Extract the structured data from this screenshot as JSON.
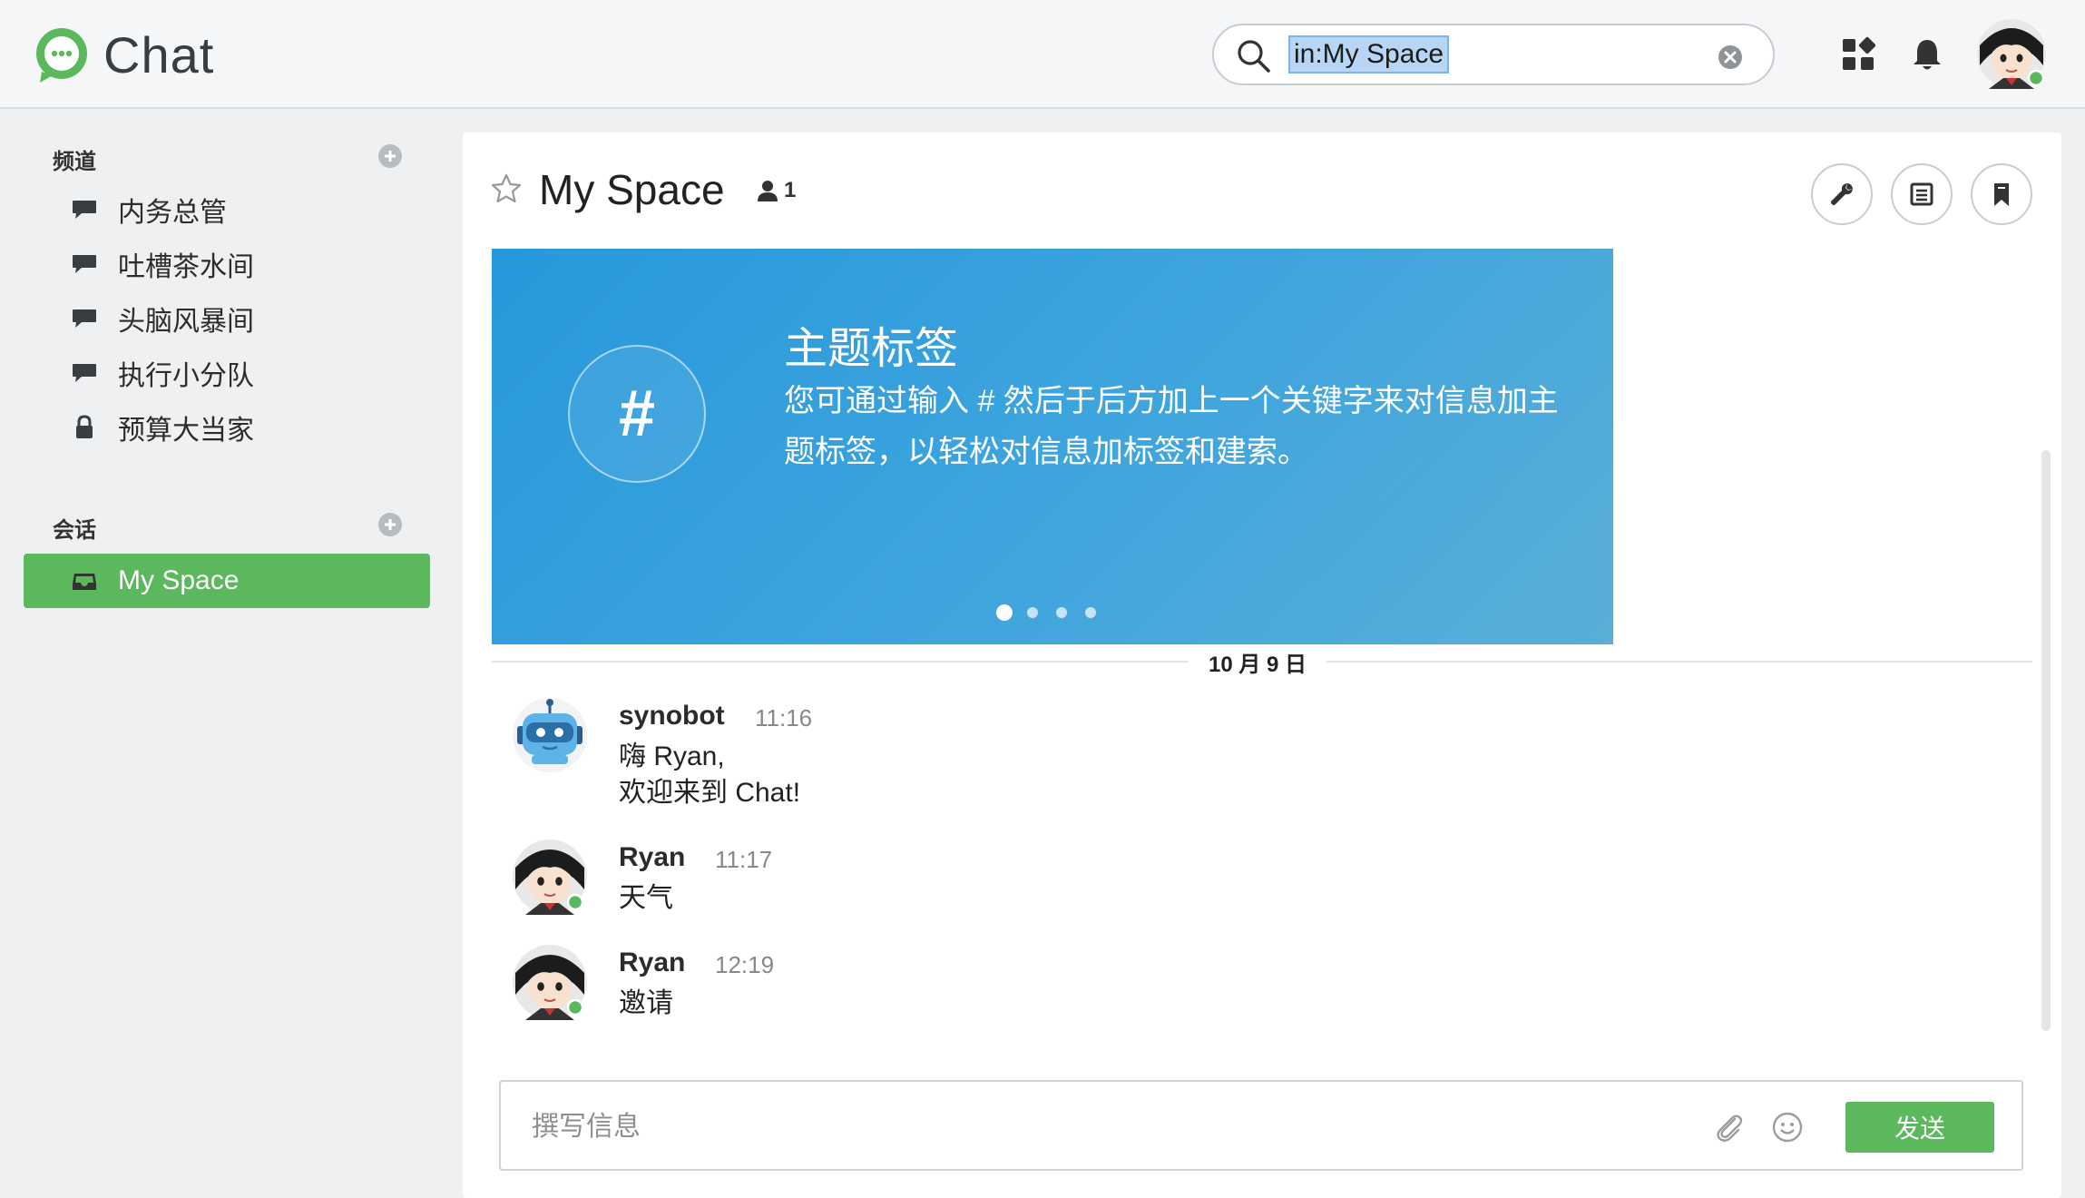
{
  "app": {
    "name": "Chat",
    "brand_color": "#5cb85c"
  },
  "search": {
    "value": "in:My Space"
  },
  "sidebar": {
    "channels_title": "频道",
    "channels": [
      {
        "label": "内务总管",
        "icon": "chat-bubble-icon"
      },
      {
        "label": "吐槽茶水间",
        "icon": "chat-bubble-icon"
      },
      {
        "label": "头脑风暴间",
        "icon": "chat-bubble-icon"
      },
      {
        "label": "执行小分队",
        "icon": "chat-bubble-icon"
      },
      {
        "label": "预算大当家",
        "icon": "lock-icon"
      }
    ],
    "conversations_title": "会话",
    "conversations": [
      {
        "label": "My Space",
        "icon": "inbox-icon",
        "active": true
      }
    ]
  },
  "channel": {
    "title": "My Space",
    "member_count": "1"
  },
  "banner": {
    "title": "主题标签",
    "description": "您可通过输入 # 然后于后方加上一个关键字来对信息加主题标签，以轻松对信息加标签和建索。",
    "dots": 4,
    "active_dot": 0
  },
  "date_divider": "10 月 9 日",
  "messages": [
    {
      "author": "synobot",
      "time": "11:16",
      "lines": [
        "嗨 Ryan,",
        "欢迎来到 Chat!"
      ],
      "avatar": "robot-avatar"
    },
    {
      "author": "Ryan",
      "time": "11:17",
      "lines": [
        "天气"
      ],
      "avatar": "user-avatar",
      "online": true
    },
    {
      "author": "Ryan",
      "time": "12:19",
      "lines": [
        "邀请"
      ],
      "avatar": "user-avatar",
      "online": true
    }
  ],
  "composer": {
    "placeholder": "撰写信息",
    "send_label": "发送"
  }
}
